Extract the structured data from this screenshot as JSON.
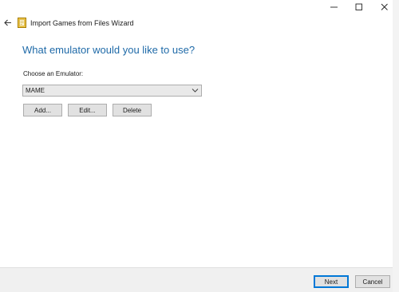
{
  "window": {
    "title": "Import Games from Files Wizard",
    "controls": {
      "minimize": "minimize-icon",
      "maximize": "maximize-icon",
      "close": "close-icon"
    }
  },
  "wizard": {
    "heading": "What emulator would you like to use?",
    "emulator_label": "Choose an Emulator:",
    "emulator_selected": "MAME",
    "buttons": {
      "add": "Add...",
      "edit": "Edit...",
      "delete": "Delete"
    }
  },
  "footer": {
    "next": "Next",
    "cancel": "Cancel"
  },
  "colors": {
    "heading": "#1f6aa8",
    "accent": "#0078d7"
  }
}
